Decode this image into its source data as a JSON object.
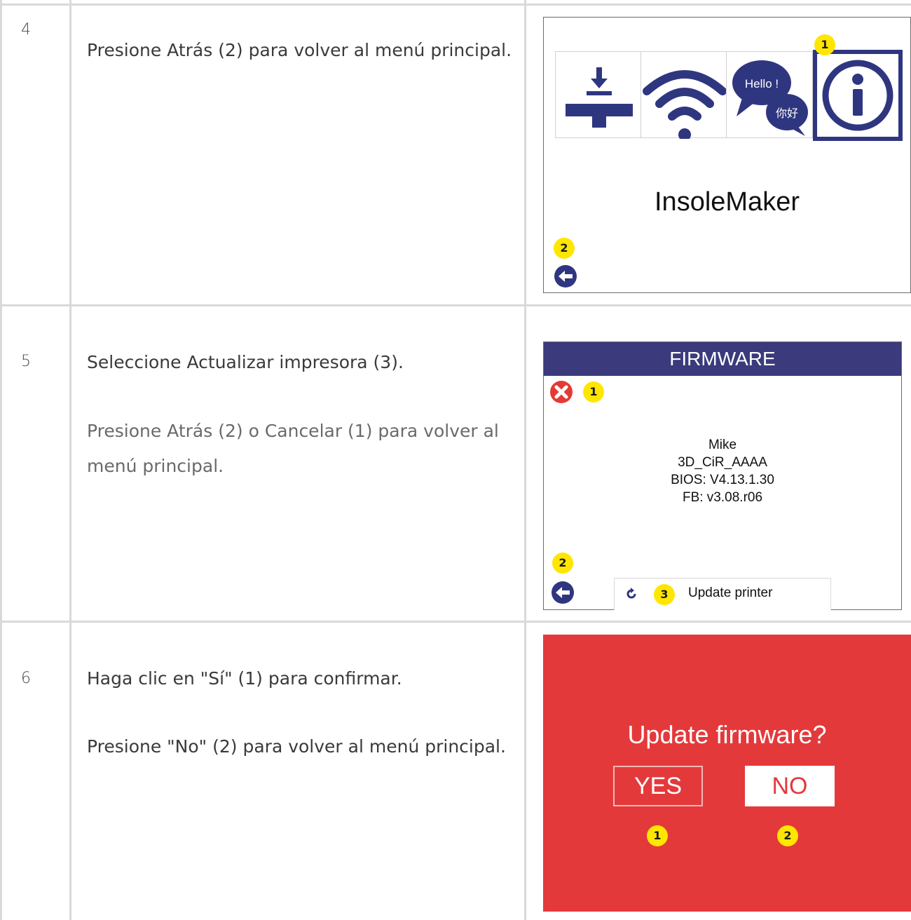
{
  "colors": {
    "navy": "#2f3680",
    "header_bg": "#3a3a7c",
    "badge_yellow": "#ffe600",
    "confirm_red": "#e4393b",
    "cancel_red": "#e53935",
    "grid": "#d9d9d9"
  },
  "rows": [
    {
      "step": "4",
      "lines": [
        "Presione Atrás (2) para volver al menú principal."
      ],
      "screen": {
        "tiles": [
          {
            "icon": "bed-level-icon"
          },
          {
            "icon": "wifi-icon"
          },
          {
            "icon": "language-icon",
            "bubble_text_1": "Hello !",
            "bubble_text_2": "你好"
          },
          {
            "icon": "info-icon"
          }
        ],
        "brand": "InsoleMaker",
        "badges": {
          "info": "1",
          "back": "2"
        },
        "back_icon": "back-arrow-icon"
      }
    },
    {
      "step": "5",
      "lines": [
        "Seleccione Actualizar impresora (3).",
        "Presione Atrás (2) o Cancelar (1) para volver al menú principal."
      ],
      "screen": {
        "header": "FIRMWARE",
        "info_lines": [
          "Mike",
          "3D_CiR_AAAA",
          "BIOS: V4.13.1.30",
          "FB: v3.08.r06"
        ],
        "update_label": "Update printer",
        "badges": {
          "cancel": "1",
          "back": "2",
          "update": "3"
        },
        "cancel_icon": "cancel-x-icon",
        "update_icon": "refresh-icon",
        "back_icon": "back-arrow-icon"
      }
    },
    {
      "step": "6",
      "lines": [
        "Haga clic en \"Sí\" (1) para confirmar.",
        "Presione \"No\" (2) para volver al menú principal."
      ],
      "screen": {
        "title": "Update firmware?",
        "yes": "YES",
        "no": "NO",
        "badges": {
          "yes": "1",
          "no": "2"
        }
      }
    }
  ]
}
